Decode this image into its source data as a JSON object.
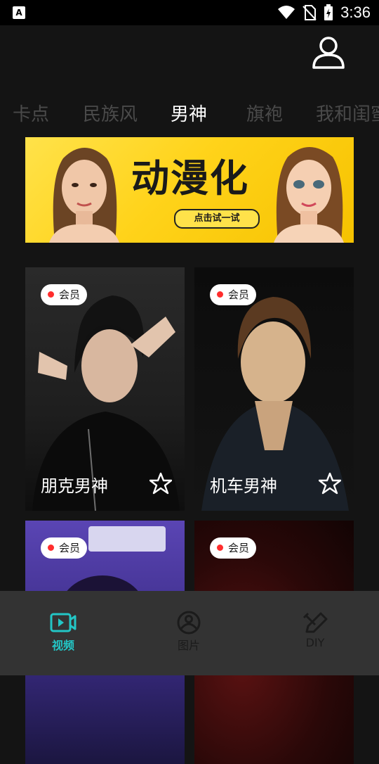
{
  "status_bar": {
    "time": "3:36"
  },
  "tabs": [
    {
      "label": "卡点",
      "active": false
    },
    {
      "label": "民族风",
      "active": false
    },
    {
      "label": "男神",
      "active": true
    },
    {
      "label": "旗袍",
      "active": false
    },
    {
      "label": "我和闺蜜",
      "active": false
    }
  ],
  "banner": {
    "title": "动漫化",
    "button": "点击试一试"
  },
  "cards": [
    {
      "badge": "会员",
      "title": "朋克男神"
    },
    {
      "badge": "会员",
      "title": "机车男神"
    },
    {
      "badge": "会员",
      "title": ""
    },
    {
      "badge": "会员",
      "title": ""
    }
  ],
  "bottom_nav": [
    {
      "label": "视频",
      "icon": "video-icon",
      "active": true
    },
    {
      "label": "图片",
      "icon": "image-icon",
      "active": false
    },
    {
      "label": "DIY",
      "icon": "pencil-icon",
      "active": false
    }
  ],
  "colors": {
    "accent": "#23c6c6",
    "badge_dot": "#ff2d2d",
    "banner_bg": "#ffd31a"
  }
}
